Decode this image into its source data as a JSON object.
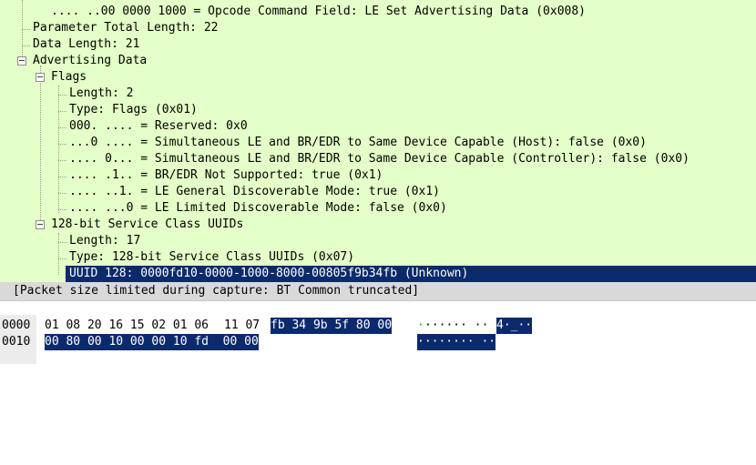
{
  "tree": {
    "rows": [
      {
        "text": ".... ..00 0000 1000 = Opcode Command Field: LE Set Advertising Data (0x008)"
      },
      {
        "text": "Parameter Total Length: 22"
      },
      {
        "text": "Data Length: 21"
      },
      {
        "text": "Advertising Data"
      },
      {
        "text": "Flags"
      },
      {
        "text": "Length: 2"
      },
      {
        "text": "Type: Flags (0x01)"
      },
      {
        "text": "000. .... = Reserved: 0x0"
      },
      {
        "text": "...0 .... = Simultaneous LE and BR/EDR to Same Device Capable (Host): false (0x0)"
      },
      {
        "text": ".... 0... = Simultaneous LE and BR/EDR to Same Device Capable (Controller): false (0x0)"
      },
      {
        "text": ".... .1.. = BR/EDR Not Supported: true (0x1)"
      },
      {
        "text": ".... ..1. = LE General Discoverable Mode: true (0x1)"
      },
      {
        "text": ".... ...0 = LE Limited Discoverable Mode: false (0x0)"
      },
      {
        "text": "128-bit Service Class UUIDs"
      },
      {
        "text": "Length: 17"
      },
      {
        "text": "Type: 128-bit Service Class UUIDs (0x07)"
      },
      {
        "text": "UUID 128: 0000fd10-0000-1000-8000-00805f9b34fb (Unknown)"
      }
    ],
    "warning": "[Packet size limited during capture: BT Common truncated]"
  },
  "hex": {
    "rows": [
      {
        "offset": "0000",
        "bytes_a": "01 08 20 16 15 02 01 06",
        "bytes_b": "11 07",
        "bytes_sel": "fb 34 9b 5f 80 00",
        "ascii_a": "·",
        "ascii_b": "······ ··",
        "ascii_sel": "4·_··"
      },
      {
        "offset": "0010",
        "bytes_a": "",
        "bytes_b": "",
        "bytes_sel": "00 80 00 10 00 00 10 fd  00 00",
        "ascii_a": "",
        "ascii_b": "",
        "ascii_sel": "········ ··"
      }
    ]
  },
  "colors": {
    "tree_background": "#e4ffc7",
    "selection": "#0b2a6e",
    "warning_background": "#d9d9d9"
  }
}
